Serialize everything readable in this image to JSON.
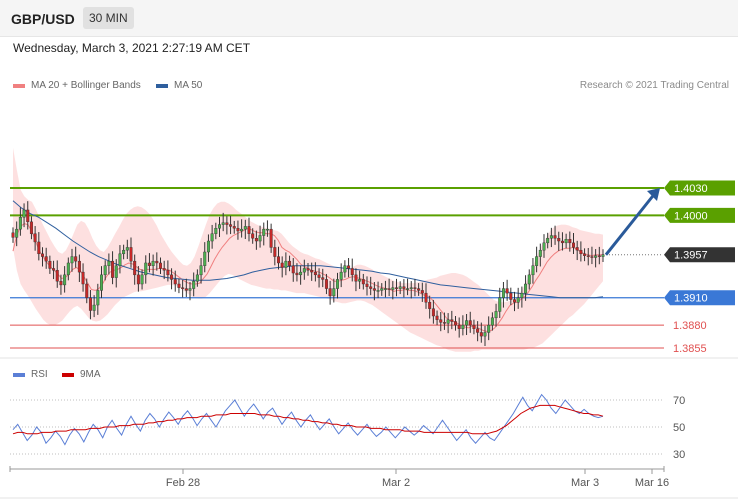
{
  "header": {
    "symbol": "GBP/USD",
    "timeframe": "30 MIN",
    "date": "Wednesday, March 3, 2021 2:27:19 AM CET"
  },
  "legend": {
    "ma20": "MA 20 + Bollinger Bands",
    "ma50": "MA 50",
    "ma20_color": "#f08080",
    "ma50_color": "#2f5f9e"
  },
  "credit": "Research © 2021 Trading Central",
  "rsi_legend": {
    "rsi": "RSI",
    "ma9": "9MA",
    "rsi_color": "#5b7fd6",
    "ma9_color": "#cc0000"
  },
  "chart_data": [
    {
      "type": "line",
      "title": "GBP/USD 30 MIN",
      "xlabel": "",
      "ylabel": "",
      "x_ticks": [
        "Feb 28",
        "Mar 2",
        "Mar 3",
        "Mar 16"
      ],
      "ylim": [
        1.3833,
        1.4137
      ],
      "grid": false,
      "levels": [
        {
          "value": 1.403,
          "label": "1.4030",
          "kind": "resistance",
          "color": "#5aa000"
        },
        {
          "value": 1.4,
          "label": "1.4000",
          "kind": "resistance",
          "color": "#5aa000"
        },
        {
          "value": 1.3957,
          "label": "1.3957",
          "kind": "last",
          "color": "#333333"
        },
        {
          "value": 1.391,
          "label": "1.3910",
          "kind": "pivot",
          "color": "#3a78d6"
        },
        {
          "value": 1.388,
          "label": "1.3880",
          "kind": "support",
          "color": "#e05050"
        },
        {
          "value": 1.3855,
          "label": "1.3855",
          "kind": "support",
          "color": "#e05050"
        }
      ],
      "close": [
        1.3976,
        1.3985,
        1.3998,
        1.4006,
        1.3993,
        1.398,
        1.3971,
        1.3958,
        1.3955,
        1.395,
        1.3942,
        1.394,
        1.3928,
        1.3924,
        1.3935,
        1.3948,
        1.3955,
        1.395,
        1.3938,
        1.3925,
        1.391,
        1.3896,
        1.3902,
        1.3918,
        1.3935,
        1.3945,
        1.395,
        1.3932,
        1.3945,
        1.3958,
        1.3962,
        1.3965,
        1.395,
        1.3935,
        1.3925,
        1.3935,
        1.3948,
        1.3945,
        1.395,
        1.3948,
        1.3942,
        1.394,
        1.3935,
        1.393,
        1.3925,
        1.3921,
        1.392,
        1.3918,
        1.392,
        1.3928,
        1.3935,
        1.3945,
        1.396,
        1.3972,
        1.398,
        1.3986,
        1.399,
        1.3992,
        1.399,
        1.3988,
        1.3986,
        1.3983,
        1.3985,
        1.3988,
        1.398,
        1.3975,
        1.3972,
        1.3978,
        1.3985,
        1.3985,
        1.3965,
        1.3955,
        1.3948,
        1.3943,
        1.395,
        1.3945,
        1.3937,
        1.3935,
        1.3938,
        1.3942,
        1.394,
        1.3938,
        1.3935,
        1.3932,
        1.393,
        1.392,
        1.3912,
        1.392,
        1.393,
        1.3938,
        1.3945,
        1.3942,
        1.3935,
        1.3928,
        1.393,
        1.3925,
        1.3922,
        1.392,
        1.3918,
        1.3918,
        1.392,
        1.392,
        1.3919,
        1.3921,
        1.392,
        1.3922,
        1.392,
        1.392,
        1.3921,
        1.392,
        1.3918,
        1.3915,
        1.3905,
        1.3898,
        1.389,
        1.3886,
        1.3883,
        1.3882,
        1.3886,
        1.3884,
        1.388,
        1.3876,
        1.388,
        1.3885,
        1.388,
        1.3876,
        1.3872,
        1.3868,
        1.3872,
        1.388,
        1.3888,
        1.3895,
        1.391,
        1.392,
        1.3915,
        1.3908,
        1.3905,
        1.391,
        1.3915,
        1.3925,
        1.3935,
        1.3945,
        1.3955,
        1.3962,
        1.397,
        1.3975,
        1.3978,
        1.3975,
        1.3972,
        1.397,
        1.3974,
        1.397,
        1.3965,
        1.3962,
        1.3958,
        1.3956,
        1.3955,
        1.3954,
        1.3956,
        1.3955,
        1.3957
      ],
      "ma20": [
        1.3961,
        1.3978,
        1.3988,
        1.3991,
        1.399,
        1.3983,
        1.3972,
        1.3962,
        1.3955,
        1.3949,
        1.3944,
        1.394,
        1.3936,
        1.3931,
        1.3932,
        1.3936,
        1.3941,
        1.3943,
        1.394,
        1.3933,
        1.3926,
        1.3919,
        1.3918,
        1.392,
        1.3925,
        1.3933,
        1.3938,
        1.394,
        1.3941,
        1.3943,
        1.3946,
        1.3948,
        1.3947,
        1.3944,
        1.3941,
        1.394,
        1.3941,
        1.3941,
        1.3941,
        1.3942,
        1.3942,
        1.3941,
        1.394,
        1.3937,
        1.3934,
        1.3931,
        1.3928,
        1.3926,
        1.3925,
        1.3925,
        1.3926,
        1.3931,
        1.3936,
        1.3944,
        1.3952,
        1.3959,
        1.3965,
        1.397,
        1.3975,
        1.3978,
        1.398,
        1.3982,
        1.3984,
        1.3986,
        1.3984,
        1.3982,
        1.3981,
        1.3981,
        1.398,
        1.398,
        1.3978,
        1.3973,
        1.3965,
        1.3962,
        1.396,
        1.3956,
        1.3952,
        1.3947,
        1.3944,
        1.3942,
        1.394,
        1.3939,
        1.3938,
        1.3936,
        1.3934,
        1.3931,
        1.3928,
        1.3928,
        1.3929,
        1.393,
        1.3932,
        1.3933,
        1.3932,
        1.3931,
        1.3929,
        1.3928,
        1.3926,
        1.3924,
        1.3922,
        1.3921,
        1.392,
        1.3919,
        1.3917,
        1.3918,
        1.3918,
        1.3919,
        1.3918,
        1.3918,
        1.3917,
        1.3915,
        1.3913,
        1.3912,
        1.3909,
        1.3904,
        1.3899,
        1.3894,
        1.3888,
        1.3885,
        1.3884,
        1.3882,
        1.388,
        1.3878,
        1.3877,
        1.3879,
        1.3878,
        1.3876,
        1.3874,
        1.3873,
        1.3874,
        1.3877,
        1.3882,
        1.3888,
        1.3895,
        1.3901,
        1.3904,
        1.3905,
        1.3908,
        1.3911,
        1.3916,
        1.3922,
        1.3929,
        1.3935,
        1.3942,
        1.3949,
        1.3954,
        1.3958,
        1.3961,
        1.3963,
        1.3964,
        1.3964,
        1.3965,
        1.3963,
        1.396,
        1.3958,
        1.3957,
        1.3956,
        1.3957,
        1.3957,
        1.3957
      ],
      "ma50": [
        1.4016,
        1.4008,
        1.4002,
        1.3998,
        1.3992,
        1.3986,
        1.3979,
        1.3972,
        1.3966,
        1.396,
        1.3955,
        1.3951,
        1.3947,
        1.3944,
        1.3941,
        1.3938,
        1.3936,
        1.3934,
        1.3932,
        1.3931,
        1.393,
        1.3929,
        1.3929,
        1.3929,
        1.393,
        1.3931,
        1.3933,
        1.3935,
        1.3938,
        1.394,
        1.3942,
        1.3943,
        1.3944,
        1.3945,
        1.3945,
        1.3945,
        1.3945,
        1.3944,
        1.3943,
        1.3942,
        1.3941,
        1.394,
        1.3939,
        1.3937,
        1.3936,
        1.3934,
        1.3932,
        1.393,
        1.3928,
        1.3926,
        1.3924,
        1.3923,
        1.3922,
        1.3921,
        1.392,
        1.3919,
        1.3918,
        1.3917,
        1.3916,
        1.3915,
        1.3914,
        1.3913,
        1.3912,
        1.3911,
        1.391,
        1.391,
        1.391,
        1.391,
        1.391,
        1.3911
      ],
      "bb_upper": [
        1.4074,
        1.405,
        1.4028,
        1.4021,
        1.4017,
        1.4015,
        1.4007,
        1.3998,
        1.3989,
        1.3981,
        1.3973,
        1.3966,
        1.396,
        1.3958,
        1.3962,
        1.397,
        1.398,
        1.399,
        1.3994,
        1.3992,
        1.3985,
        1.3975,
        1.3967,
        1.3962,
        1.396,
        1.3965,
        1.3972,
        1.398,
        1.3987,
        1.3995,
        1.4002,
        1.4006,
        1.4009,
        1.401,
        1.4009,
        1.4006,
        1.4002,
        1.3996,
        1.3989,
        1.398,
        1.3973,
        1.3966,
        1.396,
        1.3955,
        1.395,
        1.3946,
        1.3945,
        1.3948,
        1.3955,
        1.3966,
        1.3978,
        1.399,
        1.4001,
        1.4008,
        1.4013,
        1.4015,
        1.4015,
        1.4013,
        1.401,
        1.4006,
        1.4003,
        1.4,
        1.3996,
        1.3993,
        1.3991,
        1.3989,
        1.3987,
        1.3986,
        1.3985,
        1.3984,
        1.3983,
        1.398,
        1.3975,
        1.397,
        1.3966,
        1.3963,
        1.396,
        1.3958,
        1.3957,
        1.3955,
        1.3953,
        1.3952,
        1.395,
        1.3948,
        1.3946,
        1.3944,
        1.3942,
        1.3941,
        1.3941,
        1.3942,
        1.3944,
        1.3946,
        1.3946,
        1.3945,
        1.3943,
        1.3941,
        1.3938,
        1.3936,
        1.3934,
        1.3932,
        1.393,
        1.3928,
        1.3927,
        1.3926,
        1.3926,
        1.3926,
        1.3926,
        1.3927,
        1.3928,
        1.3929,
        1.393,
        1.3931,
        1.3932,
        1.3934,
        1.3935,
        1.3936,
        1.3937,
        1.3937,
        1.3936,
        1.3935,
        1.3933,
        1.393,
        1.3927,
        1.3924,
        1.392,
        1.3916,
        1.3912,
        1.3908,
        1.3906,
        1.3905,
        1.3905,
        1.3906,
        1.3908,
        1.391,
        1.3915,
        1.3922,
        1.393,
        1.394,
        1.395,
        1.396,
        1.3969,
        1.3976,
        1.3983,
        1.3987,
        1.3989,
        1.399,
        1.399,
        1.3989,
        1.3987,
        1.3986,
        1.3984,
        1.3983,
        1.3982,
        1.3981,
        1.398,
        1.398,
        1.3979
      ],
      "bb_lower": [
        1.3965,
        1.394,
        1.3925,
        1.3918,
        1.3912,
        1.3905,
        1.3898,
        1.3892,
        1.3886,
        1.3882,
        1.388,
        1.388,
        1.3882,
        1.3885,
        1.389,
        1.3895,
        1.3899,
        1.3901,
        1.3898,
        1.3893,
        1.3888,
        1.3885,
        1.3884,
        1.3885,
        1.3888,
        1.3892,
        1.3897,
        1.3902,
        1.3906,
        1.391,
        1.3912,
        1.3914,
        1.3916,
        1.3917,
        1.3917,
        1.3918,
        1.3919,
        1.392,
        1.3921,
        1.3922,
        1.3923,
        1.3924,
        1.3924,
        1.3923,
        1.3921,
        1.3918,
        1.3915,
        1.3912,
        1.391,
        1.3909,
        1.3909,
        1.3911,
        1.3915,
        1.392,
        1.3925,
        1.393,
        1.3934,
        1.3936,
        1.3935,
        1.3933,
        1.393,
        1.3928,
        1.3926,
        1.3924,
        1.3923,
        1.3922,
        1.3921,
        1.392,
        1.392,
        1.3919,
        1.3919,
        1.3918,
        1.3918,
        1.3917,
        1.3916,
        1.3915,
        1.3915,
        1.3915,
        1.3914,
        1.3913,
        1.3912,
        1.3911,
        1.391,
        1.3909,
        1.3908,
        1.3906,
        1.3905,
        1.3904,
        1.3904,
        1.3905,
        1.3906,
        1.3907,
        1.3907,
        1.3906,
        1.3904,
        1.3902,
        1.3899,
        1.3896,
        1.3893,
        1.389,
        1.3887,
        1.3884,
        1.3881,
        1.3878,
        1.3875,
        1.3872,
        1.387,
        1.3868,
        1.3866,
        1.3864,
        1.3862,
        1.386,
        1.3858,
        1.3857,
        1.3855,
        1.3853,
        1.3852,
        1.3851,
        1.3851,
        1.3851,
        1.3851,
        1.3851,
        1.3852,
        1.3852,
        1.3853,
        1.3853,
        1.3853,
        1.3853,
        1.3853,
        1.3853,
        1.3853,
        1.3853,
        1.3853,
        1.3853,
        1.3853,
        1.3853,
        1.3854,
        1.3855,
        1.3856,
        1.3858,
        1.386,
        1.3864,
        1.3868,
        1.3872,
        1.3876,
        1.388,
        1.3884,
        1.3888,
        1.3891,
        1.3895,
        1.3899,
        1.3903,
        1.3908,
        1.3913,
        1.3918,
        1.3923,
        1.3928
      ],
      "forecast": {
        "from": 1.3957,
        "to": 1.403
      }
    },
    {
      "type": "line",
      "title": "RSI",
      "ylim": [
        20,
        80
      ],
      "y_ticks": [
        70,
        50,
        30
      ],
      "rsi": [
        48,
        52,
        46,
        40,
        44,
        50,
        46,
        38,
        42,
        47,
        43,
        37,
        44,
        49,
        45,
        39,
        46,
        52,
        48,
        42,
        50,
        55,
        49,
        44,
        52,
        58,
        52,
        47,
        55,
        60,
        56,
        50,
        56,
        61,
        57,
        52,
        58,
        62,
        57,
        51,
        56,
        60,
        55,
        50,
        56,
        62,
        66,
        70,
        64,
        58,
        63,
        67,
        62,
        56,
        61,
        64,
        58,
        52,
        57,
        61,
        55,
        50,
        55,
        59,
        53,
        48,
        52,
        56,
        50,
        45,
        49,
        53,
        48,
        44,
        48,
        52,
        47,
        43,
        46,
        50,
        46,
        42,
        46,
        50,
        47,
        44,
        47,
        51,
        48,
        45,
        50,
        55,
        50,
        45,
        40,
        44,
        48,
        42,
        38,
        42,
        46,
        42,
        40,
        45,
        50,
        55,
        60,
        66,
        72,
        66,
        62,
        68,
        74,
        70,
        64,
        60,
        65,
        70,
        66,
        62,
        60,
        63,
        60,
        58,
        57,
        58
      ],
      "ma9": [
        45,
        46,
        46,
        45,
        45,
        45,
        46,
        46,
        46,
        47,
        47,
        47,
        48,
        48,
        48,
        48,
        49,
        49,
        49,
        50,
        50,
        50,
        51,
        51,
        51,
        52,
        52,
        52,
        53,
        53,
        54,
        54,
        55,
        55,
        56,
        56,
        57,
        57,
        57,
        58,
        58,
        58,
        59,
        59,
        59,
        60,
        60,
        60,
        60,
        60,
        60,
        59,
        59,
        59,
        58,
        58,
        57,
        57,
        56,
        56,
        55,
        55,
        54,
        54,
        53,
        53,
        52,
        52,
        51,
        51,
        51,
        50,
        50,
        50,
        49,
        49,
        49,
        48,
        48,
        48,
        48,
        47,
        47,
        47,
        47,
        46,
        46,
        46,
        46,
        46,
        46,
        46,
        46,
        46,
        46,
        45,
        45,
        45,
        45,
        46,
        47,
        49,
        51,
        54,
        57,
        60,
        62,
        64,
        65,
        66,
        66,
        66,
        66,
        65,
        64,
        63,
        62,
        61,
        60,
        60,
        59,
        59,
        58
      ]
    }
  ]
}
